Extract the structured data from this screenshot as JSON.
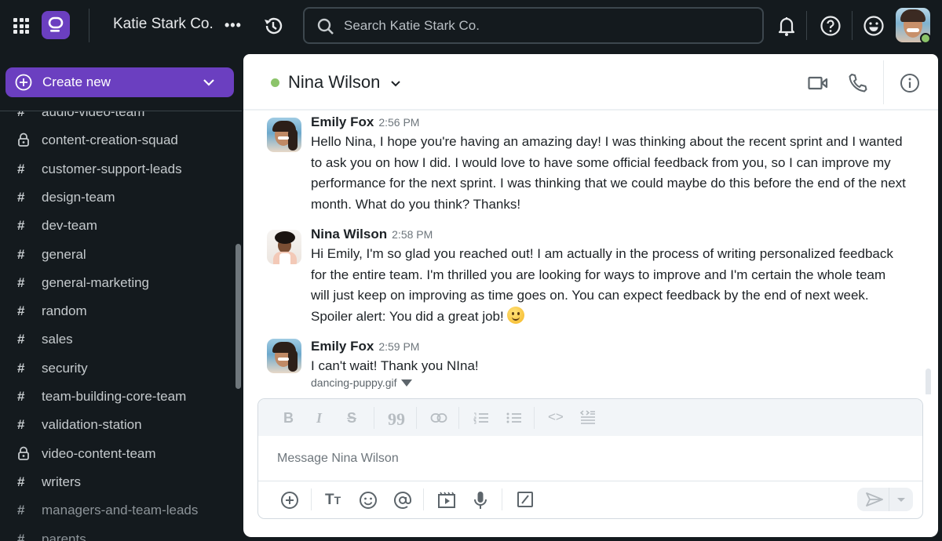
{
  "topbar": {
    "workspace_name": "Katie Stark Co.",
    "search_placeholder": "Search Katie Stark Co.",
    "user_status": "online"
  },
  "sidebar": {
    "create_new_label": "Create new",
    "channels": [
      {
        "name": "audio-video-team",
        "type": "public",
        "clipped": true
      },
      {
        "name": "content-creation-squad",
        "type": "private"
      },
      {
        "name": "customer-support-leads",
        "type": "public"
      },
      {
        "name": "design-team",
        "type": "public"
      },
      {
        "name": "dev-team",
        "type": "public"
      },
      {
        "name": "general",
        "type": "public"
      },
      {
        "name": "general-marketing",
        "type": "public"
      },
      {
        "name": "random",
        "type": "public"
      },
      {
        "name": "sales",
        "type": "public"
      },
      {
        "name": "security",
        "type": "public"
      },
      {
        "name": "team-building-core-team",
        "type": "public"
      },
      {
        "name": "validation-station",
        "type": "public"
      },
      {
        "name": "video-content-team",
        "type": "private"
      },
      {
        "name": "writers",
        "type": "public"
      },
      {
        "name": "managers-and-team-leads",
        "type": "public",
        "muted": true
      },
      {
        "name": "parents",
        "type": "public",
        "muted": true
      }
    ]
  },
  "channel": {
    "title": "Nina Wilson",
    "presence": "online"
  },
  "messages": [
    {
      "author": "Emily Fox",
      "time": "2:56 PM",
      "text": "Hello Nina, I hope you're having an amazing day! I was thinking about the recent sprint and I wanted to ask you on how I did. I would love to have some official feedback from you, so I can improve my performance for the next sprint. I was thinking that we could maybe do this before the end of the next month. What do you think? Thanks!"
    },
    {
      "author": "Nina Wilson",
      "time": "2:58 PM",
      "text": "Hi Emily, I'm so glad you reached out! I am actually in the process of writing personalized feedback for the entire team. I'm thrilled you are looking for ways to improve and I'm certain the whole team will just keep on improving as time goes on. You can expect feedback by the end of next week. Spoiler alert: You did a great job!",
      "emoji": "slightly-smiling-face"
    },
    {
      "author": "Emily Fox",
      "time": "2:59 PM",
      "text": "I can't wait! Thank you NIna!",
      "attachment": "dancing-puppy.gif"
    }
  ],
  "composer": {
    "placeholder": "Message Nina Wilson",
    "format_tools": [
      "bold",
      "italic",
      "strikethrough",
      "quote",
      "link",
      "numbered-list",
      "bulleted-list",
      "code",
      "code-block"
    ],
    "actions": [
      "add",
      "formatting",
      "emoji",
      "mention",
      "video-clip",
      "voice-message",
      "slash-command"
    ]
  },
  "colors": {
    "brand": "#6b3fc0",
    "topbar_bg": "#141a1e",
    "online": "#8cc46a"
  }
}
